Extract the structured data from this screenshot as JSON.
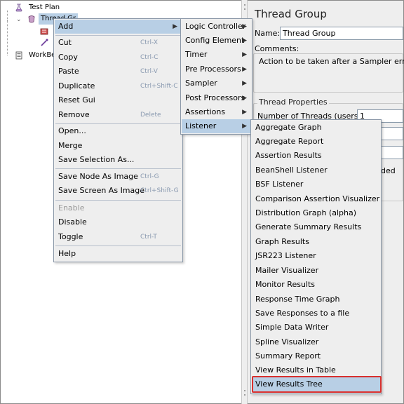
{
  "tree": {
    "root_label": "Test Plan",
    "thread_group_label": "Thread Gr",
    "workbench_label": "WorkBe"
  },
  "right_panel": {
    "title": "Thread Group",
    "name_label": "Name:",
    "name_value": "Thread Group",
    "comments_label": "Comments:",
    "error_action_label": "Action to be taken after a Sampler error",
    "thread_props_legend": "Thread Properties",
    "num_threads_label": "Number of Threads (users):",
    "num_threads_value": "1",
    "partial_text": "ded"
  },
  "context_menu": {
    "items": [
      {
        "label": "Add",
        "shortcut": "",
        "submenu": true
      },
      {
        "label": "Cut",
        "shortcut": "Ctrl-X"
      },
      {
        "label": "Copy",
        "shortcut": "Ctrl-C"
      },
      {
        "label": "Paste",
        "shortcut": "Ctrl-V"
      },
      {
        "label": "Duplicate",
        "shortcut": "Ctrl+Shift-C"
      },
      {
        "label": "Reset Gui",
        "shortcut": ""
      },
      {
        "label": "Remove",
        "shortcut": "Delete"
      },
      {
        "label": "Open...",
        "shortcut": ""
      },
      {
        "label": "Merge",
        "shortcut": ""
      },
      {
        "label": "Save Selection As...",
        "shortcut": ""
      },
      {
        "label": "Save Node As Image",
        "shortcut": "Ctrl-G"
      },
      {
        "label": "Save Screen As Image",
        "shortcut": "Ctrl+Shift-G"
      },
      {
        "label": "Enable",
        "shortcut": "",
        "disabled": true
      },
      {
        "label": "Disable",
        "shortcut": ""
      },
      {
        "label": "Toggle",
        "shortcut": "Ctrl-T"
      },
      {
        "label": "Help",
        "shortcut": ""
      }
    ]
  },
  "add_submenu": {
    "items": [
      {
        "label": "Logic Controller"
      },
      {
        "label": "Config Element"
      },
      {
        "label": "Timer"
      },
      {
        "label": "Pre Processors"
      },
      {
        "label": "Sampler"
      },
      {
        "label": "Post Processors"
      },
      {
        "label": "Assertions"
      },
      {
        "label": "Listener"
      }
    ],
    "arrow": "▶"
  },
  "listener_submenu": {
    "items": [
      {
        "label": "Aggregate Graph"
      },
      {
        "label": "Aggregate Report"
      },
      {
        "label": "Assertion Results"
      },
      {
        "label": "BeanShell Listener"
      },
      {
        "label": "BSF Listener"
      },
      {
        "label": "Comparison Assertion Visualizer"
      },
      {
        "label": "Distribution Graph (alpha)"
      },
      {
        "label": "Generate Summary Results"
      },
      {
        "label": "Graph Results"
      },
      {
        "label": "JSR223 Listener"
      },
      {
        "label": "Mailer Visualizer"
      },
      {
        "label": "Monitor Results"
      },
      {
        "label": "Response Time Graph"
      },
      {
        "label": "Save Responses to a file"
      },
      {
        "label": "Simple Data Writer"
      },
      {
        "label": "Spline Visualizer"
      },
      {
        "label": "Summary Report"
      },
      {
        "label": "View Results in Table"
      },
      {
        "label": "View Results Tree"
      }
    ]
  },
  "colors": {
    "highlight": "#b8cfe5",
    "callout_border": "#d9302e",
    "menu_bg": "#eeeeee"
  },
  "icons": [
    "flask-icon",
    "thread-group-icon",
    "workbench-icon",
    "pipette-icon",
    "submenu-arrow-icon"
  ]
}
